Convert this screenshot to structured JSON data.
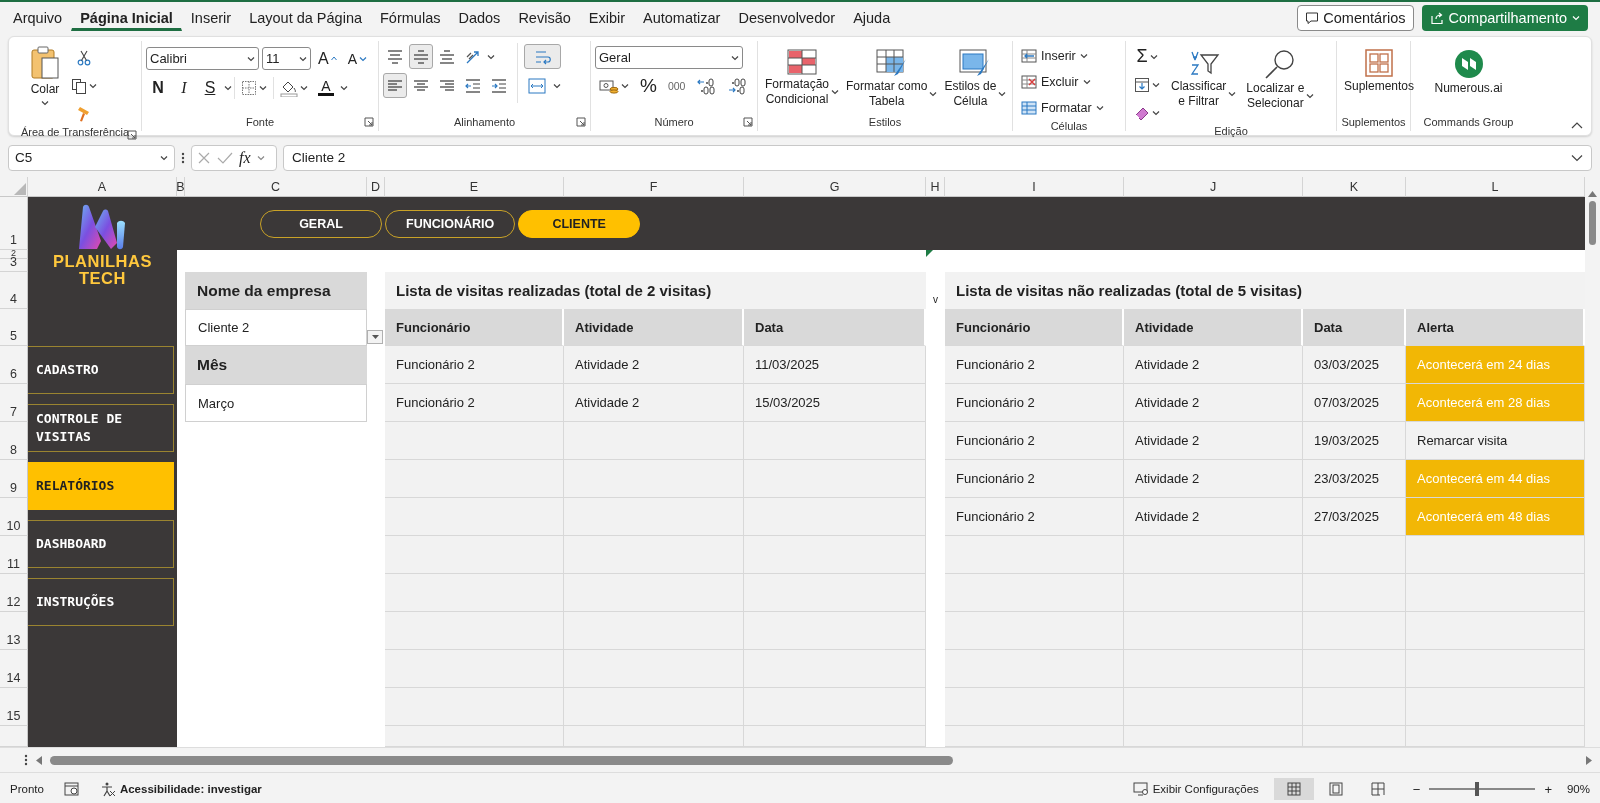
{
  "menu_tabs": [
    {
      "label": "Arquivo",
      "selected": false
    },
    {
      "label": "Página Inicial",
      "selected": true
    },
    {
      "label": "Inserir",
      "selected": false
    },
    {
      "label": "Layout da Página",
      "selected": false
    },
    {
      "label": "Fórmulas",
      "selected": false
    },
    {
      "label": "Dados",
      "selected": false
    },
    {
      "label": "Revisão",
      "selected": false
    },
    {
      "label": "Exibir",
      "selected": false
    },
    {
      "label": "Automatizar",
      "selected": false
    },
    {
      "label": "Desenvolvedor",
      "selected": false
    },
    {
      "label": "Ajuda",
      "selected": false
    }
  ],
  "comments_button": "Comentários",
  "share_button": "Compartilhamento",
  "ribbon": {
    "clipboard": {
      "paste": "Colar",
      "group_label": "Área de Transferência"
    },
    "font": {
      "font_name": "Calibri",
      "font_size": "11",
      "grow": "A",
      "shrink": "A",
      "bold": "N",
      "italic": "I",
      "underline": "S",
      "font_color": "A",
      "group_label": "Fonte"
    },
    "alignment": {
      "top_row": [
        {
          "kind": "align-top",
          "selected": false
        },
        {
          "kind": "align-middle",
          "selected": true
        },
        {
          "kind": "align-bottom",
          "selected": false
        },
        {
          "kind": "orientation",
          "selected": false
        }
      ],
      "bottom_row": [
        {
          "kind": "align-left",
          "selected": true
        },
        {
          "kind": "align-center",
          "selected": false
        },
        {
          "kind": "align-right",
          "selected": false
        },
        {
          "kind": "indent-less",
          "selected": false
        },
        {
          "kind": "indent-more",
          "selected": false
        }
      ],
      "wrap_text": {
        "selected": true
      },
      "group_label": "Alinhamento"
    },
    "number": {
      "format": "Geral",
      "percent": "%",
      "thousands": "000",
      "group_label": "Número"
    },
    "styles": {
      "buttons": [
        {
          "kind": "conditional",
          "lines": [
            "Formatação",
            "Condicional"
          ]
        },
        {
          "kind": "table",
          "lines": [
            "Formatar como",
            "Tabela"
          ]
        },
        {
          "kind": "cell-styles",
          "lines": [
            "Estilos de",
            "Célula"
          ]
        }
      ],
      "group_label": "Estilos"
    },
    "cells": {
      "buttons": [
        {
          "kind": "insert",
          "label": "Inserir"
        },
        {
          "kind": "delete",
          "label": "Excluir"
        },
        {
          "kind": "format",
          "label": "Formatar"
        }
      ],
      "group_label": "Células"
    },
    "editing": {
      "autosum": "Σ",
      "buttons": [
        {
          "kind": "sort",
          "lines": [
            "Classificar",
            "e Filtrar"
          ]
        },
        {
          "kind": "find",
          "lines": [
            "Localizar e",
            "Selecionar"
          ]
        }
      ],
      "group_label": "Edição"
    },
    "addins": {
      "label": "Suplementos",
      "group_label": "Suplementos"
    },
    "commands": {
      "label": "Numerous.ai",
      "group_label": "Commands Group"
    }
  },
  "formula_bar": {
    "name_box": "C5",
    "fx": "fx",
    "formula": "Cliente 2"
  },
  "columns": [
    "A",
    "B",
    "C",
    "D",
    "E",
    "F",
    "G",
    "H",
    "I",
    "J",
    "K",
    "L"
  ],
  "rows": [
    "1",
    "2",
    "3",
    "4",
    "5",
    "6",
    "7",
    "8",
    "9",
    "10",
    "11",
    "12",
    "13",
    "14",
    "15"
  ],
  "logo_text": "PLANILHAS TECH",
  "top_tabs": [
    {
      "label": "GERAL",
      "selected": false
    },
    {
      "label": "FUNCIONÁRIO",
      "selected": false
    },
    {
      "label": "CLIENTE",
      "selected": true
    }
  ],
  "nav": [
    {
      "label": "CADASTRO",
      "selected": false
    },
    {
      "label": "CONTROLE DE VISITAS",
      "selected": false
    },
    {
      "label": "RELATÓRIOS",
      "selected": true
    },
    {
      "label": "DASHBOARD",
      "selected": false
    },
    {
      "label": "INSTRUÇÕES",
      "selected": false
    }
  ],
  "filters": {
    "company_label": "Nome da empresa",
    "company_value": "Cliente 2",
    "month_label": "Mês",
    "month_value": "Março"
  },
  "column_h_text": "v",
  "done_visits": {
    "title": "Lista de visitas realizadas (total de 2 visitas)",
    "columns": [
      "Funcionário",
      "Atividade",
      "Data"
    ],
    "rows": [
      [
        "Funcionário 2",
        "Atividade 2",
        "11/03/2025"
      ],
      [
        "Funcionário 2",
        "Atividade 2",
        "15/03/2025"
      ]
    ]
  },
  "pending_visits": {
    "title": "Lista de visitas não realizadas (total de 5 visitas)",
    "columns": [
      "Funcionário",
      "Atividade",
      "Data",
      "Alerta"
    ],
    "rows": [
      {
        "cells": [
          "Funcionário 2",
          "Atividade 2",
          "03/03/2025"
        ],
        "alert": "Acontecerá em 24 dias",
        "highlighted": true
      },
      {
        "cells": [
          "Funcionário 2",
          "Atividade 2",
          "07/03/2025"
        ],
        "alert": "Acontecerá em 28 dias",
        "highlighted": true
      },
      {
        "cells": [
          "Funcionário 2",
          "Atividade 2",
          "19/03/2025"
        ],
        "alert": "Remarcar visita",
        "highlighted": false
      },
      {
        "cells": [
          "Funcionário 2",
          "Atividade 2",
          "23/03/2025"
        ],
        "alert": "Acontecerá em 44 dias",
        "highlighted": true
      },
      {
        "cells": [
          "Funcionário 2",
          "Atividade 2",
          "27/03/2025"
        ],
        "alert": "Acontecerá em 48 dias",
        "highlighted": true
      }
    ]
  },
  "status_bar": {
    "ready": "Pronto",
    "accessibility": "Acessibilidade: investigar",
    "display_settings": "Exibir Configurações",
    "views": [
      {
        "kind": "normal",
        "selected": true
      },
      {
        "kind": "page-layout",
        "selected": false
      },
      {
        "kind": "page-break",
        "selected": false
      }
    ],
    "zoom": {
      "minus": "−",
      "plus": "+",
      "level": 0.45,
      "percent": "90%"
    }
  }
}
